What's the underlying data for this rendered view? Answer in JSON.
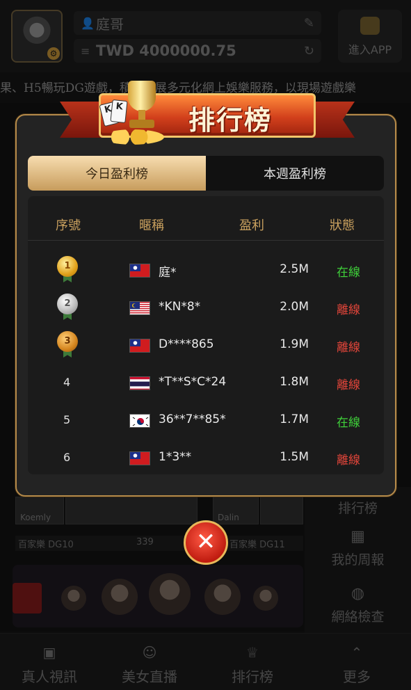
{
  "header": {
    "username": "庭哥",
    "balance": "TWD 4000000.75",
    "enter_app_label": "進入APP"
  },
  "marquee": "果、H5暢玩DG遊戲，積極發展多元化網上娛樂服務，以現場遊戲樂",
  "background": {
    "game_thumbs": [
      "Koemly",
      "Dalin"
    ],
    "game_bar": {
      "left_game": "百家樂 DG10",
      "players": "339",
      "right_game": "百家樂 DG11"
    },
    "side_menu": [
      "排行榜",
      "我的周報",
      "網絡檢查"
    ]
  },
  "bottom_nav": [
    {
      "label": "真人視訊",
      "icon": "cards-icon"
    },
    {
      "label": "美女直播",
      "icon": "hostess-icon"
    },
    {
      "label": "排行榜",
      "icon": "trophy-icon"
    },
    {
      "label": "更多",
      "icon": "chevron-up-icon"
    }
  ],
  "modal": {
    "title": "排行榜",
    "tabs": [
      {
        "label": "今日盈利榜",
        "active": true
      },
      {
        "label": "本週盈利榜",
        "active": false
      }
    ],
    "columns": [
      "序號",
      "暱稱",
      "盈利",
      "狀態"
    ],
    "rows": [
      {
        "rank": "1",
        "medal": "gold",
        "flag": "taiwan",
        "nickname": "庭*",
        "profit": "2.5M",
        "status": "在線",
        "online": true
      },
      {
        "rank": "2",
        "medal": "silver",
        "flag": "malaysia",
        "nickname": "*KN*8*",
        "profit": "2.0M",
        "status": "離線",
        "online": false
      },
      {
        "rank": "3",
        "medal": "bronze",
        "flag": "taiwan",
        "nickname": "D****865",
        "profit": "1.9M",
        "status": "離線",
        "online": false
      },
      {
        "rank": "4",
        "medal": "",
        "flag": "thailand",
        "nickname": "*T**S*C*24",
        "profit": "1.8M",
        "status": "離線",
        "online": false
      },
      {
        "rank": "5",
        "medal": "",
        "flag": "korea",
        "nickname": "36**7**85*",
        "profit": "1.7M",
        "status": "在線",
        "online": true
      },
      {
        "rank": "6",
        "medal": "",
        "flag": "taiwan",
        "nickname": "1*3**",
        "profit": "1.5M",
        "status": "離線",
        "online": false
      }
    ]
  },
  "colors": {
    "accent_gold": "#c9a05e",
    "online": "#3fd03a",
    "offline": "#e2453a",
    "close_button": "#d0261a"
  }
}
